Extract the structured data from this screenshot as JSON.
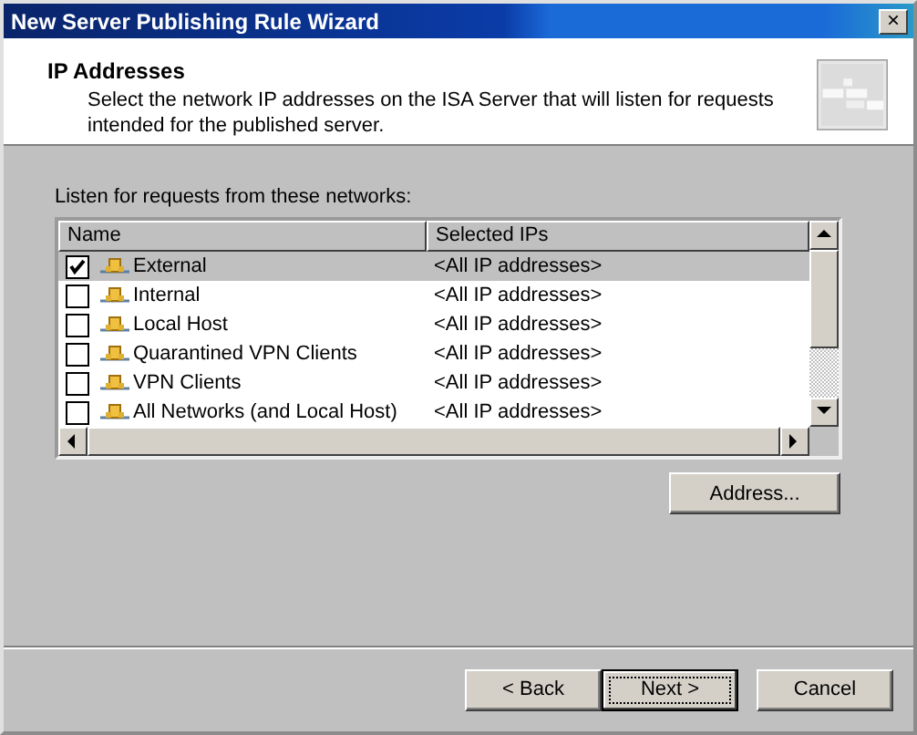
{
  "window": {
    "title": "New Server Publishing Rule Wizard",
    "close": "×"
  },
  "header": {
    "title": "IP Addresses",
    "description": "Select the network IP addresses on the ISA Server that will listen for requests intended for the published server."
  },
  "list_label": "Listen for requests from these networks:",
  "table": {
    "columns": [
      "Name",
      "Selected IPs"
    ],
    "rows": [
      {
        "name": "External",
        "ips": "<All IP addresses>",
        "checked": true,
        "selected": true
      },
      {
        "name": "Internal",
        "ips": "<All IP addresses>",
        "checked": false,
        "selected": false
      },
      {
        "name": "Local Host",
        "ips": "<All IP addresses>",
        "checked": false,
        "selected": false
      },
      {
        "name": "Quarantined VPN Clients",
        "ips": "<All IP addresses>",
        "checked": false,
        "selected": false
      },
      {
        "name": "VPN Clients",
        "ips": "<All IP addresses>",
        "checked": false,
        "selected": false
      },
      {
        "name": "All Networks (and Local Host)",
        "ips": "<All IP addresses>",
        "checked": false,
        "selected": false
      }
    ]
  },
  "address_button": "Address...",
  "buttons": [
    {
      "label": "< Back",
      "default": false
    },
    {
      "label": "Next >",
      "default": true
    },
    {
      "label": "Cancel",
      "default": false
    }
  ]
}
